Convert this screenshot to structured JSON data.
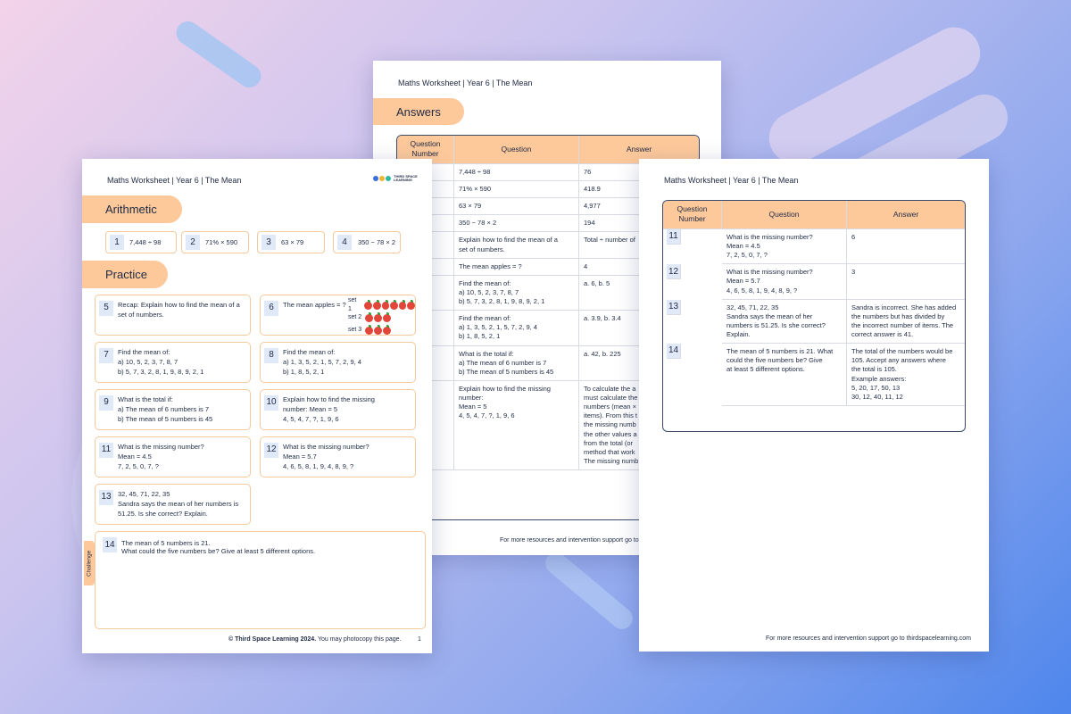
{
  "header": "Maths Worksheet | Year 6 | The Mean",
  "logo": {
    "line1": "THIRD SPACE",
    "line2": "LEARNING",
    "colors": [
      "#3a6fe0",
      "#f2b631",
      "#2fb8a2"
    ]
  },
  "front": {
    "arithmetic_title": "Arithmetic",
    "arithmetic": [
      {
        "n": "1",
        "q": "7,448 ÷ 98"
      },
      {
        "n": "2",
        "q": "71% × 590"
      },
      {
        "n": "3",
        "q": "63 × 79"
      },
      {
        "n": "4",
        "q": "350 − 78 × 2"
      }
    ],
    "practice_title": "Practice",
    "questions": [
      {
        "n": "5",
        "q": "Recap: Explain how to find the mean of a\nset of numbers."
      },
      {
        "n": "6",
        "q": "The mean apples = ?",
        "sets": [
          "set 1",
          "set 2",
          "set 3"
        ]
      },
      {
        "n": "7",
        "q": "Find the mean of:\na) 10, 5, 2, 3, 7, 8, 7\nb) 5, 7, 3, 2, 8, 1, 9, 8, 9, 2, 1"
      },
      {
        "n": "8",
        "q": "Find the mean of:\na) 1, 3, 5, 2, 1, 5, 7, 2, 9, 4\nb) 1, 8, 5, 2, 1"
      },
      {
        "n": "9",
        "q": "What is the total if:\na) The mean of 6 numbers is 7\nb) The mean of 5 numbers is 45"
      },
      {
        "n": "10",
        "q": "Explain how to find the missing\nnumber: Mean = 5\n4, 5, 4, 7, ?, 1, 9, 6"
      },
      {
        "n": "11",
        "q": "What is the missing number?\nMean = 4.5\n7, 2, 5, 0, 7, ?"
      },
      {
        "n": "12",
        "q": "What is the missing number?\nMean = 5.7\n4, 6, 5, 8, 1, 9, 4, 8, 9, ?"
      },
      {
        "n": "13",
        "q": "32, 45, 71, 22, 35\nSandra says the mean of her numbers is\n51.25. Is she correct? Explain."
      }
    ],
    "challenge_label": "Challenge",
    "challenge": {
      "n": "14",
      "q": "The mean of 5 numbers is 21.\nWhat could the five numbers be? Give at least 5 different options."
    },
    "footer_bold": "© Third Space Learning 2024.",
    "footer_rest": " You may photocopy this page.",
    "page_number": "1"
  },
  "answers_page": {
    "title": "Answers",
    "columns": [
      "Question\nNumber",
      "Question",
      "Answer"
    ],
    "rows": [
      {
        "n": "",
        "q": "7,448 ÷ 98",
        "a": "76"
      },
      {
        "n": "",
        "q": "71% × 590",
        "a": "418.9"
      },
      {
        "n": "",
        "q": "63 × 79",
        "a": "4,977"
      },
      {
        "n": "",
        "q": "350 − 78 × 2",
        "a": "194"
      },
      {
        "n": "",
        "q": "Explain how to find the mean of a\nset of numbers.",
        "a": "Total ÷ number of"
      },
      {
        "n": "",
        "q": "The mean apples = ?",
        "a": "4"
      },
      {
        "n": "",
        "q": "Find the mean of:\na) 10, 5, 2, 3, 7, 8, 7\nb) 5, 7, 3, 2, 8, 1, 9, 8, 9, 2, 1",
        "a": "a. 6, b. 5"
      },
      {
        "n": "",
        "q": "Find the mean of:\na) 1, 3, 5, 2, 1, 5, 7, 2, 9, 4\nb) 1, 8, 5, 2, 1",
        "a": "a. 3.9, b. 3.4"
      },
      {
        "n": "",
        "q": "What is the total if:\na) The mean of 6 number is 7\nb) The mean of 5 numbers is 45",
        "a": "a. 42, b. 225"
      },
      {
        "n": "",
        "q": "Explain how to find the missing\nnumber:\nMean = 5\n4, 5, 4, 7, ?, 1, 9, 6",
        "a": "To calculate the a\nmust calculate the\nnumbers (mean ×\nitems). From this t\nthe missing numb\nthe other values a\nfrom the total (or\nmethod that work\nThe missing numb"
      }
    ],
    "footer": "For more resources and intervention support go to"
  },
  "answers_page2": {
    "columns": [
      "Question\nNumber",
      "Question",
      "Answer"
    ],
    "rows": [
      {
        "n": "11",
        "q": "What is the missing number?\nMean = 4.5\n7, 2, 5, 0, 7, ?",
        "a": "6"
      },
      {
        "n": "12",
        "q": "What is the missing number?\nMean = 5.7\n4, 6, 5, 8, 1, 9, 4, 8, 9, ?",
        "a": "3"
      },
      {
        "n": "13",
        "q": "32, 45, 71, 22, 35\nSandra says the mean of her\nnumbers is 51.25. Is she correct?\nExplain.",
        "a": "Sandra is incorrect. She has added\nthe numbers but has divided by\nthe incorrect number of items. The\ncorrect answer is 41."
      },
      {
        "n": "14",
        "q": "The mean of 5 numbers is 21. What\ncould the five numbers be? Give\nat least 5 different options.",
        "a": "The total of the numbers would be\n105. Accept any answers where\nthe total is 105.\nExample answers:\n5, 20, 17, 50, 13\n30, 12, 40, 11, 12"
      }
    ],
    "footer": "For more resources and intervention support go to thirdspacelearning.com"
  }
}
